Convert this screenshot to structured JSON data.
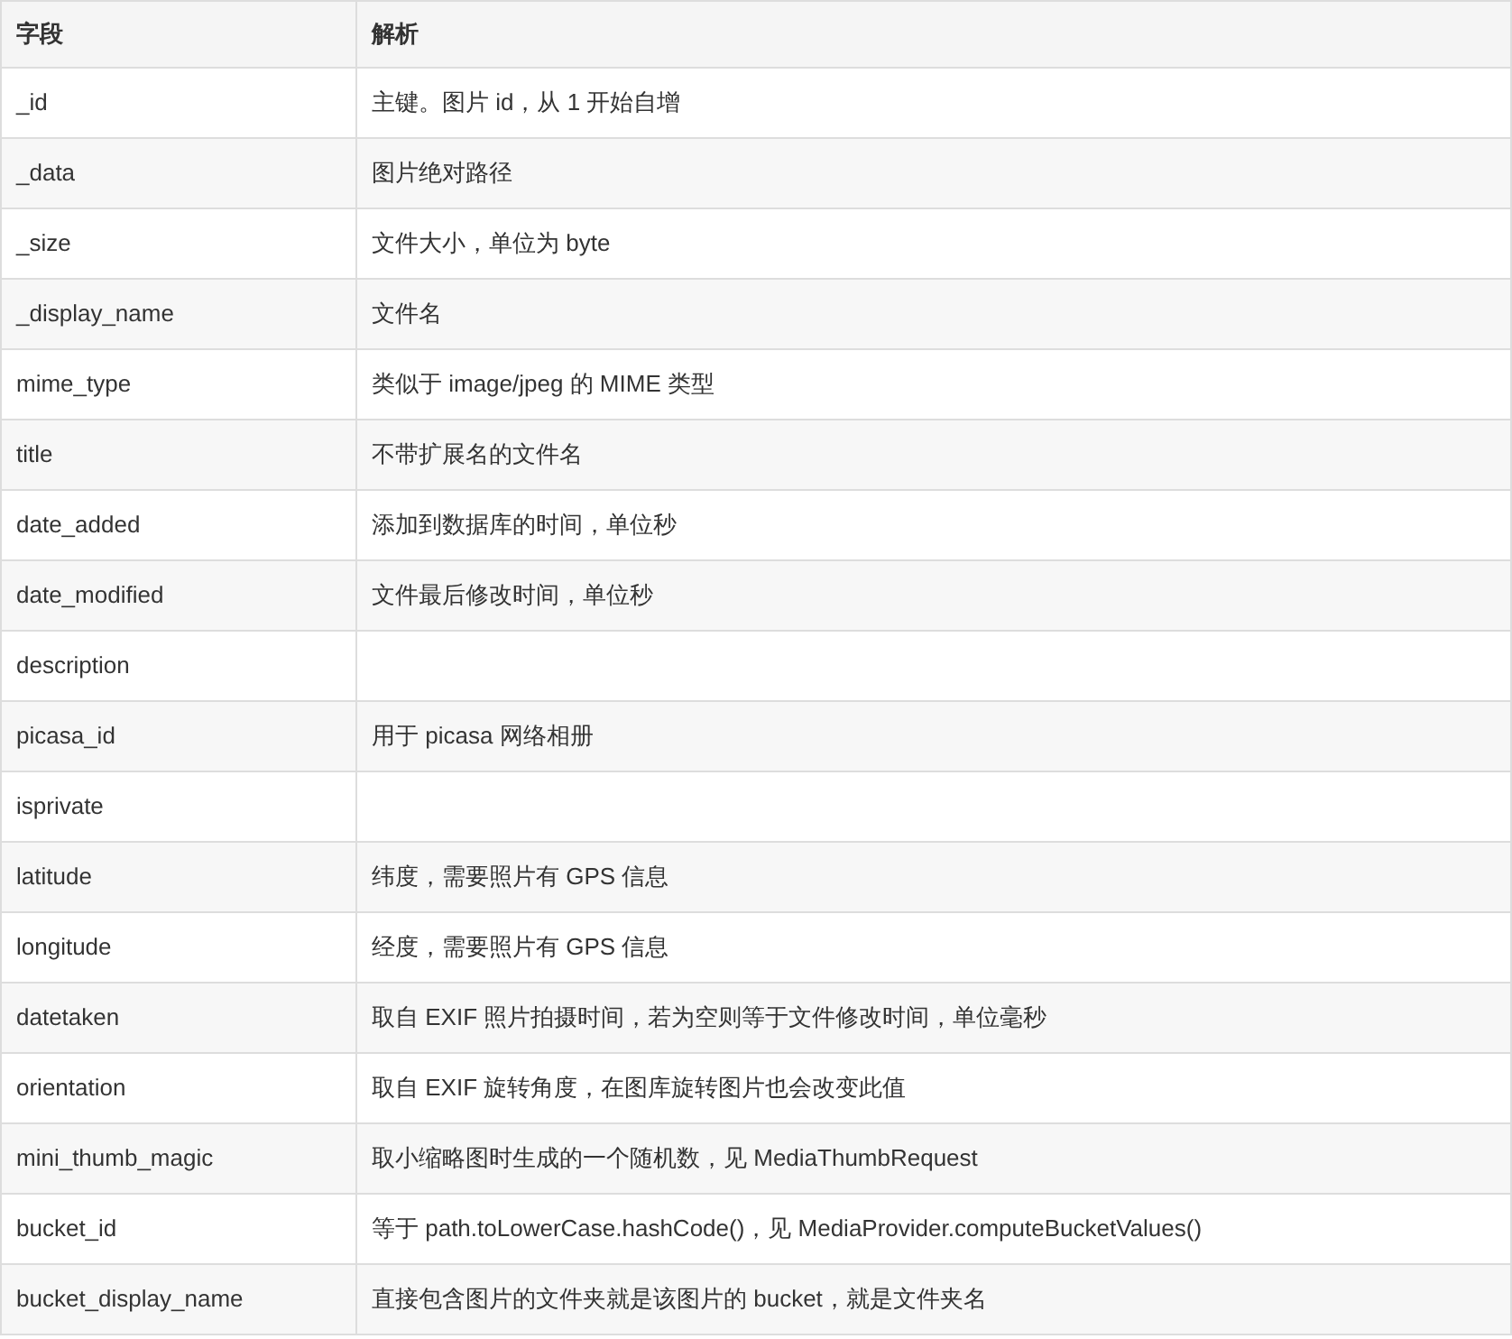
{
  "table": {
    "columns": [
      "字段",
      "解析"
    ],
    "rows": [
      {
        "field": "_id",
        "description": "主键。图片 id，从 1 开始自增"
      },
      {
        "field": "_data",
        "description": "图片绝对路径"
      },
      {
        "field": "_size",
        "description": "文件大小，单位为 byte"
      },
      {
        "field": "_display_name",
        "description": "文件名"
      },
      {
        "field": "mime_type",
        "description": "类似于 image/jpeg 的 MIME 类型"
      },
      {
        "field": "title",
        "description": "不带扩展名的文件名"
      },
      {
        "field": "date_added",
        "description": "添加到数据库的时间，单位秒"
      },
      {
        "field": "date_modified",
        "description": "文件最后修改时间，单位秒"
      },
      {
        "field": "description"
      },
      {
        "field": "picasa_id",
        "description": "用于 picasa 网络相册"
      },
      {
        "field": "isprivate"
      },
      {
        "field": "latitude",
        "description": "纬度，需要照片有 GPS 信息"
      },
      {
        "field": "longitude",
        "description": "经度，需要照片有 GPS 信息"
      },
      {
        "field": "datetaken",
        "description": "取自 EXIF 照片拍摄时间，若为空则等于文件修改时间，单位毫秒"
      },
      {
        "field": "orientation",
        "description": "取自 EXIF 旋转角度，在图库旋转图片也会改变此值"
      },
      {
        "field": "mini_thumb_magic",
        "description": "取小缩略图时生成的一个随机数，见 MediaThumbRequest"
      },
      {
        "field": "bucket_id",
        "description": "等于 path.toLowerCase.hashCode()，见 MediaProvider.computeBucketValues()"
      },
      {
        "field": "bucket_display_name",
        "description": "直接包含图片的文件夹就是该图片的 bucket，就是文件夹名"
      }
    ]
  }
}
